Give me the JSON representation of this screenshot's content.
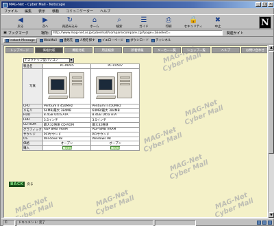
{
  "window": {
    "title": "MAG-Net - Cyber Mall - Netscape",
    "buttons": [
      "_",
      "□",
      "×"
    ]
  },
  "menu": [
    "ファイル",
    "編集",
    "表示",
    "移動",
    "コミュニケーター",
    "ヘルプ"
  ],
  "toolbar": {
    "buttons": [
      {
        "label": "戻る",
        "icon": "back-arrow-icon",
        "glyph": "◀"
      },
      {
        "label": "次へ",
        "icon": "forward-arrow-icon",
        "glyph": "▶"
      },
      {
        "label": "再読み込み",
        "icon": "reload-icon",
        "glyph": "↻"
      },
      {
        "label": "ホーム",
        "icon": "home-icon",
        "glyph": "⌂"
      },
      {
        "label": "検索",
        "icon": "search-icon",
        "glyph": "⌕"
      },
      {
        "label": "ガイド",
        "icon": "guide-icon",
        "glyph": "☰"
      },
      {
        "label": "印刷",
        "icon": "print-icon",
        "glyph": "⎙"
      },
      {
        "label": "セキュリティ",
        "icon": "security-lock-icon",
        "glyph": "🔒"
      },
      {
        "label": "中止",
        "icon": "stop-icon",
        "glyph": "✖"
      }
    ],
    "logo": "N"
  },
  "location": {
    "bookmarks_label": "ブックマーク",
    "label": "場所:",
    "url": "http://www.mag-net.or.jp/cybermall/compare/compare.cgi?page=2&select=",
    "related_label": "関連サイト"
  },
  "personal_toolbar": [
    "Instant Message",
    "WebMail",
    "連絡先",
    "人物を探す",
    "イエローページ",
    "ダウンロード",
    "チャンネル"
  ],
  "page": {
    "tabs": [
      {
        "label": "トップページ",
        "active": false
      },
      {
        "label": "価格比較",
        "active": true
      },
      {
        "label": "機能比較",
        "active": false
      },
      {
        "label": "用途検索",
        "active": false
      },
      {
        "label": "新着情報",
        "active": false
      },
      {
        "label": "メーカー一覧",
        "active": false
      },
      {
        "label": "ショップ一覧",
        "active": false
      },
      {
        "label": "ヘルプ",
        "active": false
      },
      {
        "label": "お問い合わせ",
        "active": false
      }
    ],
    "selector": {
      "value": "デスクトップ型パソコン"
    },
    "products": [
      {
        "name": "PC-MV45",
        "image": "desktop-pc-image"
      },
      {
        "name": "PC-V4507",
        "image": "desktop-pc-image"
      }
    ],
    "spec_rows": [
      {
        "label": "CPU",
        "values": [
          "Pentium II 450MHz",
          "Pentium II 450MHz"
        ]
      },
      {
        "label": "メモリ",
        "values": [
          "64MB/最大 384MB",
          "64MB/最大 384MB"
        ]
      },
      {
        "label": "HDD",
        "values": [
          "8.4GB Ultra ATA",
          "8.4GB Ultra ATA"
        ]
      },
      {
        "label": "FDD",
        "values": [
          "3.5インチ",
          "3.5インチ"
        ]
      },
      {
        "label": "CD-ROM",
        "values": [
          "最大32倍速 CD-ROM",
          "最大32倍速"
        ]
      },
      {
        "label": "グラフィック",
        "values": [
          "AGP 8MB VRAM",
          "AGP 8MB VRAM"
        ]
      },
      {
        "label": "サウンド",
        "values": [
          "PCIサウンド",
          "PCIサウンド"
        ]
      },
      {
        "label": "OS",
        "values": [
          "Windows 98",
          "Windows 98"
        ]
      },
      {
        "label": "価格",
        "values": [
          "オープン",
          "オープン"
        ]
      }
    ],
    "cart_row_label": "購入",
    "cart_label": "購入する",
    "name_row_label": "製品名",
    "image_row_label": "写真",
    "back_label": "BACK",
    "back_text": "戻る",
    "watermark_lines": [
      "MAG-Net",
      "Cyber Mall"
    ]
  },
  "status": {
    "percent": "",
    "message": "ドキュメント: 完了",
    "progress": ""
  }
}
